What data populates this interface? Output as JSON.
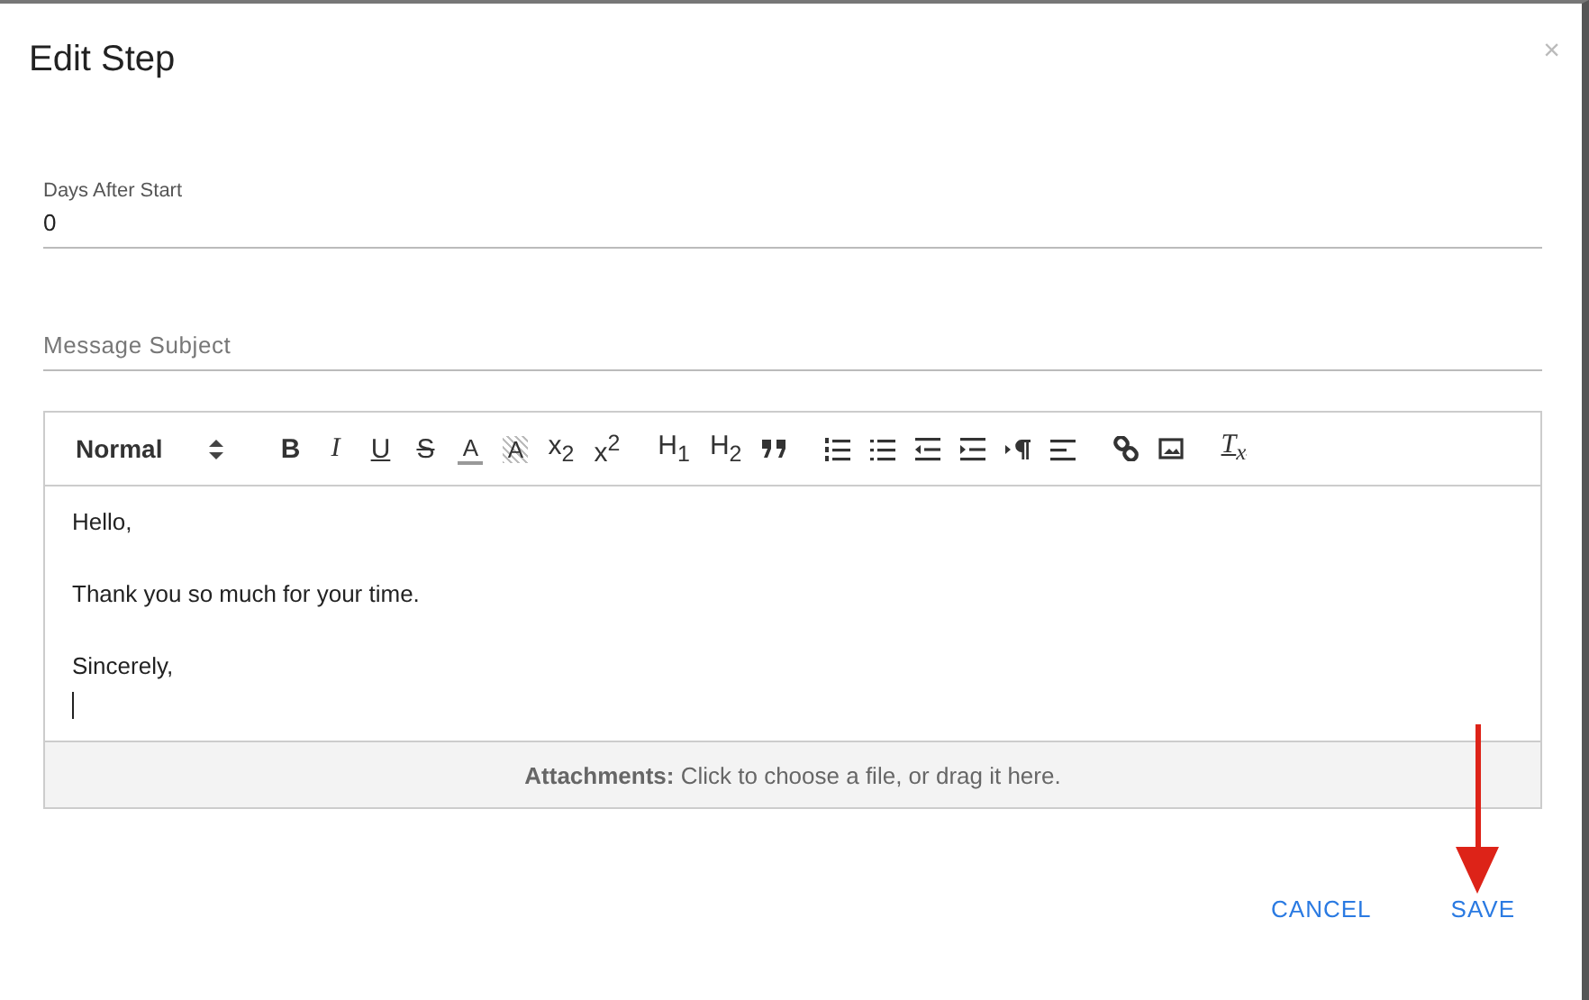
{
  "dialog": {
    "title": "Edit Step",
    "close": "×"
  },
  "fields": [
    {
      "label": "Days After Start",
      "value": "0"
    },
    {
      "placeholder": "Message Subject"
    }
  ],
  "editor": {
    "format": "Normal",
    "toolbar": [
      [
        {
          "kind": "bold",
          "text": "B"
        },
        {
          "kind": "italic",
          "text": "I"
        },
        {
          "kind": "underline",
          "text": "U"
        },
        {
          "kind": "strike",
          "text": "S"
        },
        {
          "kind": "color",
          "text": "A"
        },
        {
          "kind": "background",
          "text": "A"
        },
        {
          "kind": "text",
          "text": "x$_{2}$"
        },
        {
          "kind": "text",
          "text": "x$^{2}$"
        }
      ],
      [
        {
          "kind": "text",
          "text": "H$_{1}$"
        },
        {
          "kind": "text",
          "text": "H$_{2}$"
        },
        {
          "kind": "quote"
        }
      ],
      [
        {
          "kind": "ordered-list"
        },
        {
          "kind": "bullet-list"
        },
        {
          "kind": "outdent"
        },
        {
          "kind": "indent"
        },
        {
          "kind": "direction"
        },
        {
          "kind": "align"
        }
      ],
      [
        {
          "kind": "link"
        },
        {
          "kind": "image"
        }
      ],
      [
        {
          "kind": "clear",
          "text": "T$_{x}$"
        }
      ]
    ],
    "lines": [
      "Hello,",
      "Thank you so much for your time.",
      "Sincerely,"
    ],
    "attachments": "**Attachments:** Click to choose a file, or drag it here."
  },
  "buttons": [
    "CANCEL",
    "SAVE"
  ]
}
